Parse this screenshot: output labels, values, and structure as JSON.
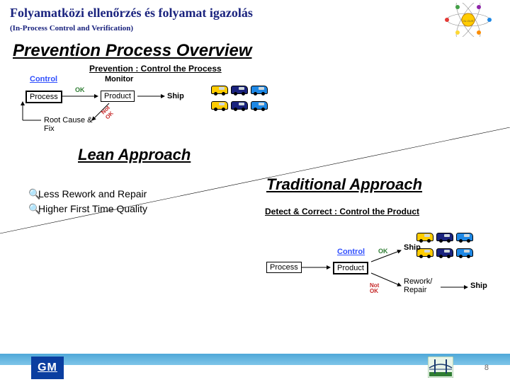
{
  "title": "Folyamatközi ellenőrzés és folyamat igazolás",
  "subtitle": "(In-Process Control and Verification)",
  "section1": {
    "heading": "Prevention Process Overview",
    "sub": "Prevention : Control the Process",
    "control": "Control",
    "monitor": "Monitor",
    "ship": "Ship",
    "process": "Process",
    "product": "Product",
    "ok": "OK",
    "notok": "Not OK",
    "rootfix": "Root Cause & Fix"
  },
  "lean": {
    "heading": "Lean Approach",
    "b1": "Less Rework and Repair",
    "b2": "Higher First Time Quality"
  },
  "trad": {
    "heading": "Traditional  Approach",
    "sub": "Detect & Correct : Control the Product",
    "control": "Control",
    "ship1": "Ship",
    "process": "Process",
    "product": "Product",
    "ok": "OK",
    "notok": "Not OK",
    "rework": "Rework/ Repair",
    "ship2": "Ship"
  },
  "footer": {
    "gm": "GM",
    "page": "8"
  },
  "atom": {
    "c": "JU-GUS"
  }
}
